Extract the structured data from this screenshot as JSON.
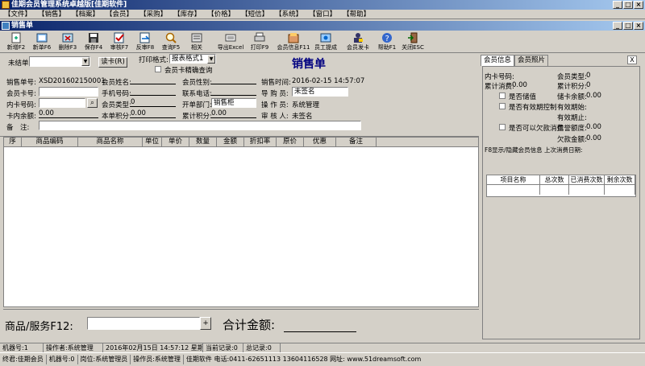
{
  "window": {
    "title": "佳期会员管理系统卓越版[佳期软件]"
  },
  "menu": [
    "【文件】",
    "【销售】",
    "【档案】",
    "【会员】",
    "【采购】",
    "【库存】",
    "【价格】",
    "【短信】",
    "【系统】",
    "【窗口】",
    "【帮助】"
  ],
  "inner_title": "销售单",
  "toolbar": [
    {
      "label": "新增F2",
      "icon": "new-icon"
    },
    {
      "label": "新单F6",
      "icon": "new-order-icon"
    },
    {
      "label": "删除F3",
      "icon": "delete-icon"
    },
    {
      "label": "保存F4",
      "icon": "save-icon"
    },
    {
      "label": "审核F7",
      "icon": "audit-icon"
    },
    {
      "label": "反审F8",
      "icon": "unaudit-icon"
    },
    {
      "label": "查询F5",
      "icon": "search-icon"
    },
    {
      "label": "相关",
      "icon": "related-icon"
    },
    {
      "label": "导出Excel",
      "icon": "export-icon"
    },
    {
      "label": "打印F9",
      "icon": "print-icon"
    },
    {
      "label": "会员信息F11",
      "icon": "member-info-icon"
    },
    {
      "label": "员工提成",
      "icon": "commission-icon"
    },
    {
      "label": "会员发卡",
      "icon": "card-issue-icon"
    },
    {
      "label": "帮助F1",
      "icon": "help-icon"
    },
    {
      "label": "关闭ESC",
      "icon": "close-icon"
    }
  ],
  "form": {
    "status_label": "未结单",
    "read_card_button": "读卡(R)",
    "print_format_label": "打印格式:",
    "print_format_value": "报表格式1",
    "precise_query_label": "会员卡精确查询",
    "heading": "销售单",
    "order_no_label": "销售单号:",
    "order_no_value": "XSD201602150001",
    "member_name_label": "会员姓名:",
    "member_gender_label": "会员性别:",
    "sale_time_label": "销售时间:",
    "sale_time_value": "2016-02-15 14:57:07",
    "card_no_label": "会员卡号:",
    "phone_label": "手机号码:",
    "contact_label": "联系电话:",
    "guide_label": "导 购 员:",
    "guide_value": "未签名",
    "inner_card_label": "内卡号码:",
    "member_type_label": "会员类型:",
    "member_type_value": "0",
    "dept_label": "开单部门:",
    "dept_value": "销售柜",
    "operator_label": "操 作 员:",
    "operator_value": "系统管理",
    "card_balance_label": "卡内余额:",
    "card_balance_value": "0.00",
    "order_points_label": "本单积分:",
    "order_points_value": "0.00",
    "total_points_label": "累计积分:",
    "total_points_value": "0.00",
    "auditor_label": "审 核 人:",
    "auditor_value": "未签名",
    "remark_label": "备　注:"
  },
  "grid": {
    "columns": [
      "序",
      "商品编码",
      "商品名称",
      "单位",
      "单价",
      "数量",
      "金额",
      "折扣率",
      "原价",
      "优惠",
      "备注"
    ]
  },
  "bottom": {
    "product_label": "商品/服务F12:",
    "total_label": "合计金额:"
  },
  "side": {
    "tabs": [
      "会员信息",
      "会员照片"
    ],
    "close": "X",
    "card_no_label": "内卡号码:",
    "member_type_label": "会员类型:",
    "member_type_value": "0",
    "total_spend_label": "累计消费:",
    "total_spend_value": "0.00",
    "total_points_label": "累计积分:",
    "total_points_value": "0",
    "stored_value_label": "是否储值",
    "stored_balance_label": "储卡余额:",
    "stored_balance_value": "0.00",
    "validity_label": "是否有效期控制",
    "valid_from_label": "有效期始:",
    "valid_to_label": "有效期止:",
    "debt_label": "是否可以欠款消费",
    "credit_label": "信誉额度:",
    "credit_value": "0.00",
    "debt_amount_label": "欠款金额:",
    "debt_amount_value": "0.00",
    "hint": "F8显示/隐藏会员信息 上次消费日期:",
    "table_headers": [
      "项目名称",
      "总次数",
      "已消费次数",
      "剩余次数"
    ]
  },
  "status": [
    "机器号:1",
    "操作者:系统管理",
    "2016年02月15日 14:57:12 星期一",
    "当前记录:0",
    "总记录:0"
  ],
  "footer": [
    "终君:佳期会员",
    "机器号:0",
    "岗位:系统管理员",
    "操作员:系统管理",
    "佳期软件 电话:0411-62651113 13604116528 网址: www.51dreamsoft.com"
  ]
}
